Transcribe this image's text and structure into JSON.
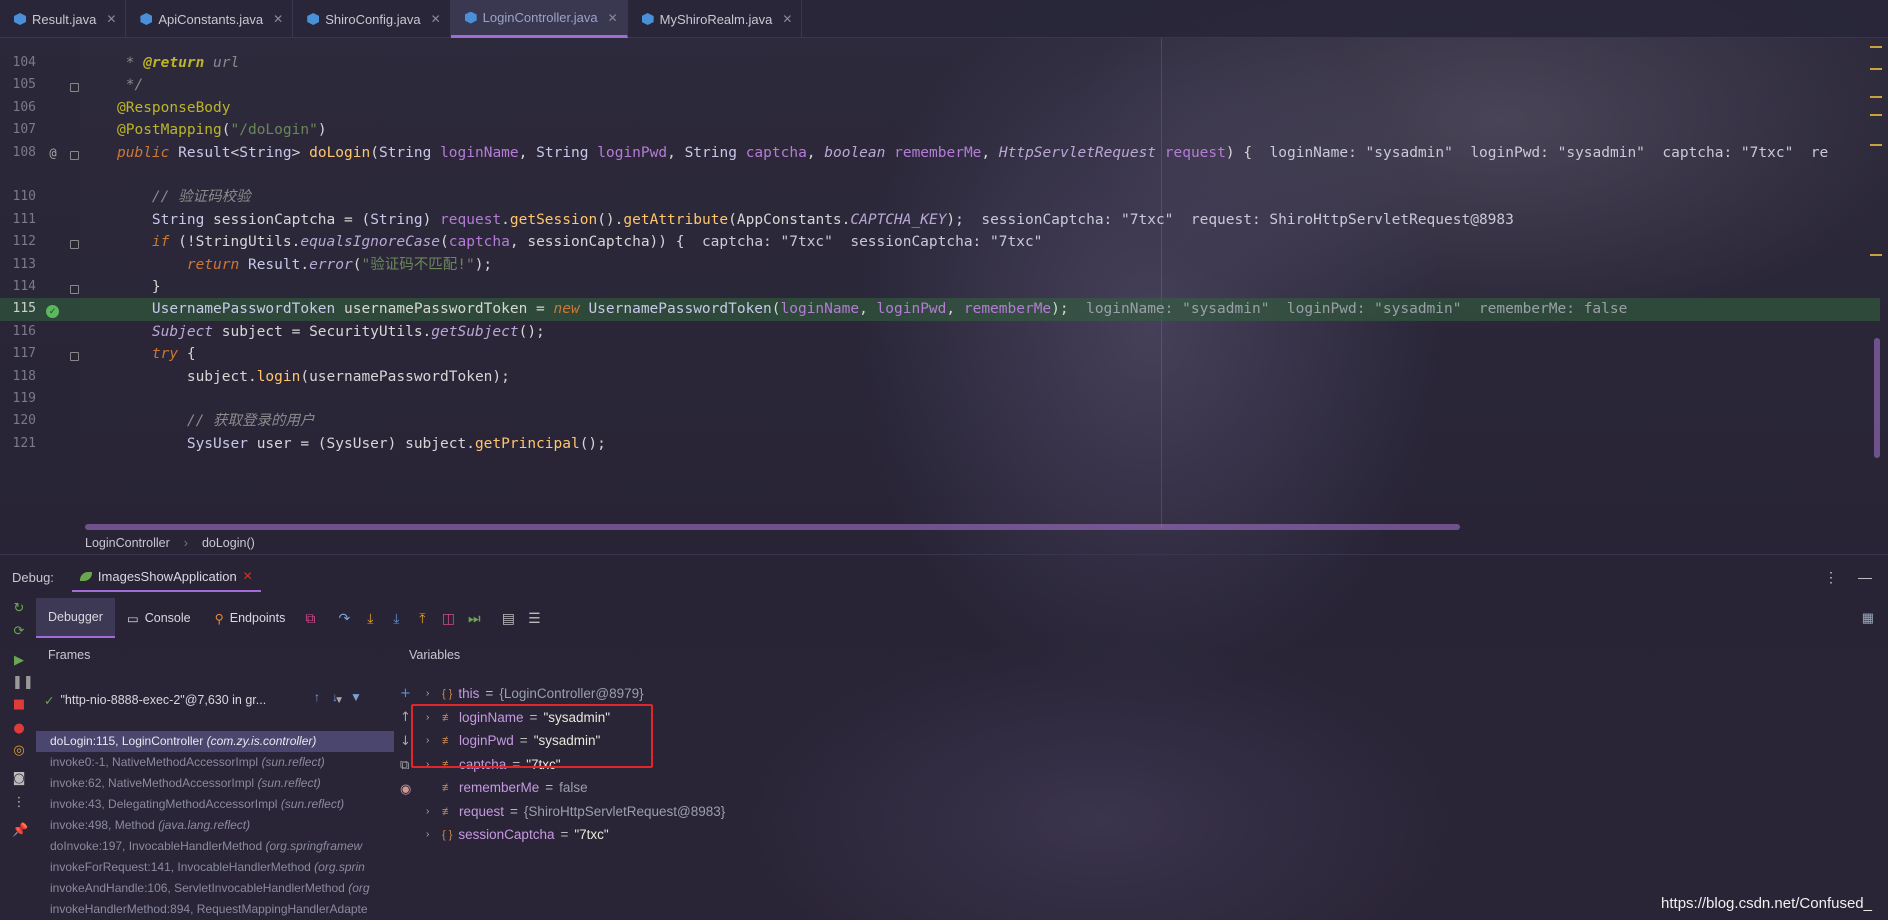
{
  "tabs": [
    {
      "label": "Result.java",
      "active": false
    },
    {
      "label": "ApiConstants.java",
      "active": false
    },
    {
      "label": "ShiroConfig.java",
      "active": false
    },
    {
      "label": "LoginController.java",
      "active": true
    },
    {
      "label": "MyShiroRealm.java",
      "active": false
    }
  ],
  "editor": {
    "lines": [
      {
        "num": "104",
        "gmark": "",
        "fold": false,
        "html": "<span class='cm'> * </span><span class='an' style='font-style:italic;font-weight:bold'>@return</span><span class='cm'> url</span>"
      },
      {
        "num": "105",
        "gmark": "",
        "fold": true,
        "html": "<span class='cm'> */</span>"
      },
      {
        "num": "106",
        "gmark": "",
        "fold": false,
        "html": "<span class='an'>@ResponseBody</span>"
      },
      {
        "num": "107",
        "gmark": "",
        "fold": false,
        "html": "<span class='an'>@PostMapping</span><span class='va'>(</span><span class='st'>\"/doLogin\"</span><span class='va'>)</span>"
      },
      {
        "num": "108",
        "gmark": "@",
        "fold": true,
        "html": "<span class='kw'>public</span> <span class='ty'>Result</span><span class='va'>&lt;</span><span class='ty'>String</span><span class='va'>&gt; </span><span class='fn'>doLogin</span><span class='va'>(</span><span class='ty'>String</span> <span class='pr'>loginName</span><span class='va'>, </span><span class='ty'>String</span> <span class='pr'>loginPwd</span><span class='va'>, </span><span class='ty'>String</span> <span class='pr'>captcha</span><span class='va'>, </span><span class='ti'>boolean</span> <span class='pr'>rememberMe</span><span class='va'>, </span><span class='ti'>HttpServletRequest</span> <span class='pr'>request</span><span class='va'>) {  </span><span class='iv'>loginName: \"sysadmin\"  loginPwd: \"sysadmin\"  captcha: \"7txc\"  re</span>"
      },
      {
        "num": "110",
        "gmark": "",
        "fold": false,
        "html": "    <span class='cm'>// 验证码校验</span>"
      },
      {
        "num": "111",
        "gmark": "",
        "fold": false,
        "html": "    <span class='ty'>String</span> <span class='va'>sessionCaptcha = (</span><span class='ty'>String</span><span class='va'>) </span><span class='pr'>request</span><span class='va'>.</span><span class='fn'>getSession</span><span class='va'>().</span><span class='fn'>getAttribute</span><span class='va'>(AppConstants.</span><span class='ti'>CAPTCHA_KEY</span><span class='va'>);  </span><span class='iv'>sessionCaptcha: \"7txc\"  request: ShiroHttpServletRequest@8983</span>"
      },
      {
        "num": "112",
        "gmark": "",
        "fold": true,
        "html": "    <span class='kw'>if</span> <span class='va'>(!StringUtils.</span><span class='ti'>equalsIgnoreCase</span><span class='va'>(</span><span class='pr'>captcha</span><span class='va'>, sessionCaptcha)) {  </span><span class='iv'>captcha: \"7txc\"  sessionCaptcha: \"7txc\"</span>"
      },
      {
        "num": "113",
        "gmark": "",
        "fold": false,
        "html": "        <span class='kw'>return</span> <span class='ty'>Result</span><span class='va'>.</span><span class='ti'>error</span><span class='va'>(</span><span class='st'>\"验证码不匹配!\"</span><span class='va'>);</span>"
      },
      {
        "num": "114",
        "gmark": "",
        "fold": true,
        "html": "    <span class='va'>}</span>"
      },
      {
        "num": "115",
        "gmark": "ok",
        "fold": false,
        "hl": true,
        "html": "    <span class='ty'>UsernamePasswordToken</span> <span class='va'>usernamePasswordToken = </span><span class='kw'>new</span> <span class='ty'>UsernamePasswordToken</span><span class='va'>(</span><span class='pr'>loginName</span><span class='va'>, </span><span class='pr'>loginPwd</span><span class='va'>, </span><span class='pr'>rememberMe</span><span class='va'>);  </span><span class='iv dim'>loginName: \"sysadmin\"  loginPwd: \"sysadmin\"  rememberMe: false</span>"
      },
      {
        "num": "116",
        "gmark": "",
        "fold": false,
        "html": "    <span class='ti'>Subject</span> <span class='va'>subject = SecurityUtils.</span><span class='ti'>getSubject</span><span class='va'>();</span>"
      },
      {
        "num": "117",
        "gmark": "",
        "fold": true,
        "html": "    <span class='kw'>try</span> <span class='va'>{</span>"
      },
      {
        "num": "118",
        "gmark": "",
        "fold": false,
        "html": "        <span class='va'>subject.</span><span class='fn'>login</span><span class='va'>(usernamePasswordToken);</span>"
      },
      {
        "num": "119",
        "gmark": "",
        "fold": false,
        "html": ""
      },
      {
        "num": "120",
        "gmark": "",
        "fold": false,
        "html": "        <span class='cm'>// 获取登录的用户</span>"
      },
      {
        "num": "121",
        "gmark": "",
        "fold": false,
        "html": "        <span class='ty'>SysUser</span> <span class='va'>user = (SysUser) subject.</span><span class='fn'>getPrincipal</span><span class='va'>();</span>"
      }
    ]
  },
  "breadcrumb": {
    "class": "LoginController",
    "method": "doLogin()"
  },
  "debug": {
    "label": "Debug:",
    "session": "ImagesShowApplication"
  },
  "debugger_tabs": [
    "Debugger",
    "Console",
    "Endpoints"
  ],
  "frames": {
    "header": "Frames",
    "thread": "\"http-nio-8888-exec-2\"@7,630 in gr...",
    "items": [
      {
        "method": "doLogin:115, LoginController",
        "pkg": "(com.zy.is.controller)",
        "selected": true
      },
      {
        "method": "invoke0:-1, NativeMethodAccessorImpl",
        "pkg": "(sun.reflect)"
      },
      {
        "method": "invoke:62, NativeMethodAccessorImpl",
        "pkg": "(sun.reflect)"
      },
      {
        "method": "invoke:43, DelegatingMethodAccessorImpl",
        "pkg": "(sun.reflect)"
      },
      {
        "method": "invoke:498, Method",
        "pkg": "(java.lang.reflect)"
      },
      {
        "method": "doInvoke:197, InvocableHandlerMethod",
        "pkg": "(org.springframew"
      },
      {
        "method": "invokeForRequest:141, InvocableHandlerMethod",
        "pkg": "(org.sprin"
      },
      {
        "method": "invokeAndHandle:106, ServletInvocableHandlerMethod",
        "pkg": "(org"
      },
      {
        "method": "invokeHandlerMethod:894, RequestMappingHandlerAdapte",
        "pkg": ""
      }
    ]
  },
  "variables": {
    "header": "Variables",
    "items": [
      {
        "icon": "{ }",
        "name": "this",
        "value": "{LoginController@8979}",
        "kind": "obj"
      },
      {
        "icon": "≢",
        "name": "loginName",
        "value": "\"sysadmin\"",
        "kind": "str"
      },
      {
        "icon": "≢",
        "name": "loginPwd",
        "value": "\"sysadmin\"",
        "kind": "str"
      },
      {
        "icon": "≢",
        "name": "captcha",
        "value": "\"7txc\"",
        "kind": "str"
      },
      {
        "icon": "≢",
        "name": "rememberMe",
        "value": "false",
        "kind": "obj",
        "noarrow": true
      },
      {
        "icon": "≢",
        "name": "request",
        "value": "{ShiroHttpServletRequest@8983}",
        "kind": "obj"
      },
      {
        "icon": "{ }",
        "name": "sessionCaptcha",
        "value": "\"7txc\"",
        "kind": "str"
      }
    ]
  },
  "watermark": "https://blog.csdn.net/Confused_"
}
